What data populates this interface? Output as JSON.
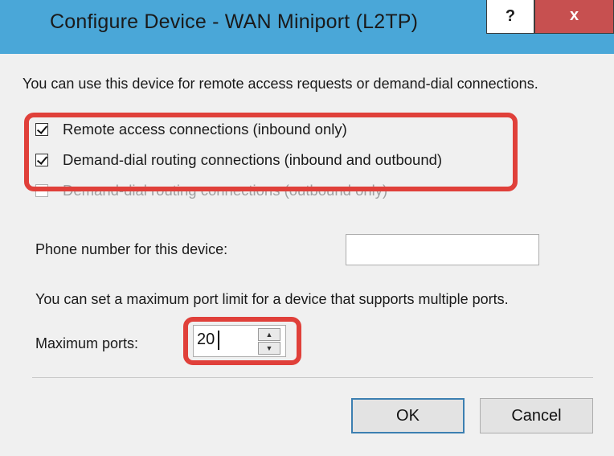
{
  "window": {
    "title": "Configure Device - WAN Miniport (L2TP)",
    "help_label": "?",
    "close_label": "x"
  },
  "description": "You can use this device for remote access requests or demand-dial connections.",
  "options": [
    {
      "label": "Remote access connections (inbound only)",
      "checked": true,
      "enabled": true
    },
    {
      "label": "Demand-dial routing connections (inbound and outbound)",
      "checked": true,
      "enabled": true
    },
    {
      "label": "Demand-dial routing connections (outbound only)",
      "checked": false,
      "enabled": false
    }
  ],
  "phone": {
    "label": "Phone number for this device:",
    "value": ""
  },
  "port_note": "You can set a maximum port limit for a device that supports multiple ports.",
  "max_ports": {
    "label": "Maximum ports:",
    "value": "20",
    "up_icon": "▲",
    "down_icon": "▼"
  },
  "buttons": {
    "ok": "OK",
    "cancel": "Cancel"
  },
  "colors": {
    "titlebar": "#4aa7d8",
    "close": "#c75050",
    "highlight": "#e0403a"
  }
}
